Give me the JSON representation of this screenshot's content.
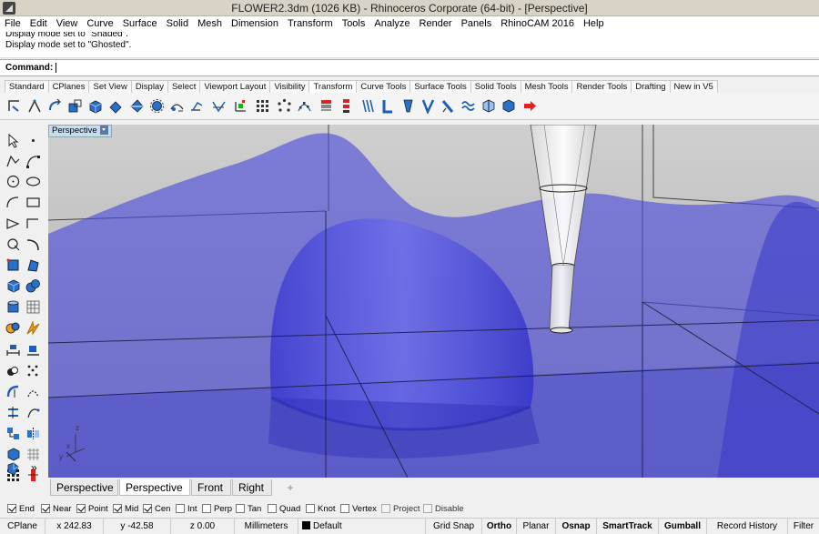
{
  "window": {
    "title": "FLOWER2.3dm (1026 KB) - Rhinoceros Corporate (64-bit) - [Perspective]"
  },
  "menu": [
    "File",
    "Edit",
    "View",
    "Curve",
    "Surface",
    "Solid",
    "Mesh",
    "Dimension",
    "Transform",
    "Tools",
    "Analyze",
    "Render",
    "Panels",
    "RhinoCAM 2016",
    "Help"
  ],
  "command_history": [
    "Display mode set to \"Shaded\".",
    "Display mode set to \"Ghosted\"."
  ],
  "command": {
    "prompt": "Command:"
  },
  "toolbar_tabs": [
    "Standard",
    "CPlanes",
    "Set View",
    "Display",
    "Select",
    "Viewport Layout",
    "Visibility",
    "Transform",
    "Curve Tools",
    "Surface Tools",
    "Solid Tools",
    "Mesh Tools",
    "Render Tools",
    "Drafting",
    "New in V5"
  ],
  "active_toolbar_tab": "Transform",
  "viewport": {
    "label": "Perspective"
  },
  "viewport_tabs": [
    "Perspective",
    "Perspective",
    "Front",
    "Right"
  ],
  "add_tab_symbol": "+",
  "axes": {
    "x": "x",
    "y": "y",
    "z": "z"
  },
  "left_expand": "»",
  "osnap": [
    {
      "label": "End",
      "checked": true
    },
    {
      "label": "Near",
      "checked": true
    },
    {
      "label": "Point",
      "checked": true
    },
    {
      "label": "Mid",
      "checked": true
    },
    {
      "label": "Cen",
      "checked": true
    },
    {
      "label": "Int",
      "checked": false
    },
    {
      "label": "Perp",
      "checked": false
    },
    {
      "label": "Tan",
      "checked": false
    },
    {
      "label": "Quad",
      "checked": false
    },
    {
      "label": "Knot",
      "checked": false
    },
    {
      "label": "Vertex",
      "checked": false
    },
    {
      "label": "Project",
      "checked": false,
      "disabled": true
    },
    {
      "label": "Disable",
      "checked": false,
      "disabled": true
    }
  ],
  "status": {
    "cplane": "CPlane",
    "x": "x 242.83",
    "y": "y -42.58",
    "z": "z 0.00",
    "units": "Millimeters",
    "layer": "Default",
    "grid_snap": "Grid Snap",
    "ortho": "Ortho",
    "planar": "Planar",
    "osnap": "Osnap",
    "smarttrack": "SmartTrack",
    "gumball": "Gumball",
    "record_history": "Record History",
    "filter": "Filter"
  },
  "colors": {
    "ghost_surface": "#4b4bdc",
    "viewport_bg": "#b8b8b8",
    "viewport_label_bg": "#c9dcef"
  }
}
